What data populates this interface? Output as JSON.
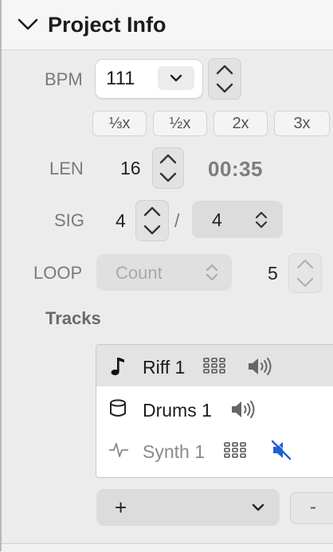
{
  "header": {
    "title": "Project Info"
  },
  "bpm": {
    "label": "BPM",
    "value": "111",
    "multipliers": [
      "⅓x",
      "½x",
      "2x",
      "3x"
    ]
  },
  "len": {
    "label": "LEN",
    "value": "16",
    "duration": "00:35"
  },
  "sig": {
    "label": "SIG",
    "numerator": "4",
    "separator": "/",
    "denominator": "4"
  },
  "loop": {
    "label": "LOOP",
    "mode": "Count",
    "count": "5"
  },
  "tracks": {
    "heading": "Tracks",
    "items": [
      {
        "name": "Riff 1",
        "icon": "music-note-icon",
        "selected": true,
        "muted": false
      },
      {
        "name": "Drums 1",
        "icon": "drum-icon",
        "selected": false,
        "muted": false
      },
      {
        "name": "Synth 1",
        "icon": "waveform-icon",
        "selected": false,
        "muted": true
      }
    ]
  },
  "actions": {
    "add_label": "+",
    "remove_label": "-"
  },
  "colors": {
    "accent": "#1f5fd6",
    "panel": "#ececec"
  }
}
